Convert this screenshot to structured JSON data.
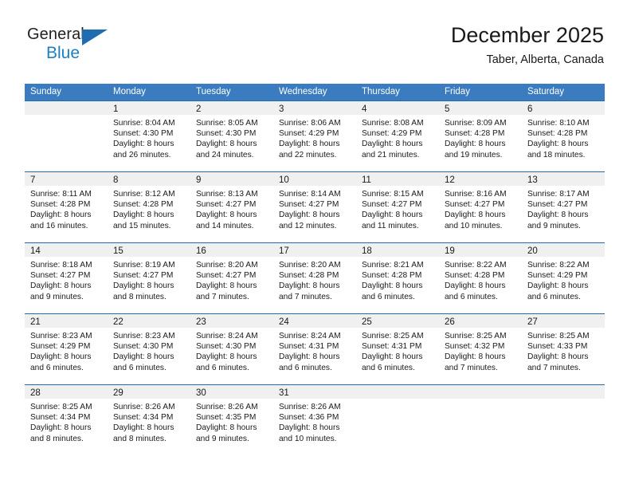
{
  "brand": {
    "name_part1": "General",
    "name_part2": "Blue",
    "triangle_icon": "triangle-icon",
    "accent_dark": "#231f20",
    "accent_blue": "#1c7fc4",
    "triangle_blue": "#1f6cb0"
  },
  "header": {
    "title": "December 2025",
    "subtitle": "Taber, Alberta, Canada"
  },
  "colors": {
    "header_bar": "#3a7cbf",
    "row_divider": "#1f6cb0",
    "daynum_band": "#f0f0f0",
    "text": "#1a1a1a"
  },
  "weekdays": [
    "Sunday",
    "Monday",
    "Tuesday",
    "Wednesday",
    "Thursday",
    "Friday",
    "Saturday"
  ],
  "weeks": [
    [
      {
        "day": "",
        "sunrise": "",
        "sunset": "",
        "daylight_line1": "",
        "daylight_line2": ""
      },
      {
        "day": "1",
        "sunrise": "Sunrise: 8:04 AM",
        "sunset": "Sunset: 4:30 PM",
        "daylight_line1": "Daylight: 8 hours",
        "daylight_line2": "and 26 minutes."
      },
      {
        "day": "2",
        "sunrise": "Sunrise: 8:05 AM",
        "sunset": "Sunset: 4:30 PM",
        "daylight_line1": "Daylight: 8 hours",
        "daylight_line2": "and 24 minutes."
      },
      {
        "day": "3",
        "sunrise": "Sunrise: 8:06 AM",
        "sunset": "Sunset: 4:29 PM",
        "daylight_line1": "Daylight: 8 hours",
        "daylight_line2": "and 22 minutes."
      },
      {
        "day": "4",
        "sunrise": "Sunrise: 8:08 AM",
        "sunset": "Sunset: 4:29 PM",
        "daylight_line1": "Daylight: 8 hours",
        "daylight_line2": "and 21 minutes."
      },
      {
        "day": "5",
        "sunrise": "Sunrise: 8:09 AM",
        "sunset": "Sunset: 4:28 PM",
        "daylight_line1": "Daylight: 8 hours",
        "daylight_line2": "and 19 minutes."
      },
      {
        "day": "6",
        "sunrise": "Sunrise: 8:10 AM",
        "sunset": "Sunset: 4:28 PM",
        "daylight_line1": "Daylight: 8 hours",
        "daylight_line2": "and 18 minutes."
      }
    ],
    [
      {
        "day": "7",
        "sunrise": "Sunrise: 8:11 AM",
        "sunset": "Sunset: 4:28 PM",
        "daylight_line1": "Daylight: 8 hours",
        "daylight_line2": "and 16 minutes."
      },
      {
        "day": "8",
        "sunrise": "Sunrise: 8:12 AM",
        "sunset": "Sunset: 4:28 PM",
        "daylight_line1": "Daylight: 8 hours",
        "daylight_line2": "and 15 minutes."
      },
      {
        "day": "9",
        "sunrise": "Sunrise: 8:13 AM",
        "sunset": "Sunset: 4:27 PM",
        "daylight_line1": "Daylight: 8 hours",
        "daylight_line2": "and 14 minutes."
      },
      {
        "day": "10",
        "sunrise": "Sunrise: 8:14 AM",
        "sunset": "Sunset: 4:27 PM",
        "daylight_line1": "Daylight: 8 hours",
        "daylight_line2": "and 12 minutes."
      },
      {
        "day": "11",
        "sunrise": "Sunrise: 8:15 AM",
        "sunset": "Sunset: 4:27 PM",
        "daylight_line1": "Daylight: 8 hours",
        "daylight_line2": "and 11 minutes."
      },
      {
        "day": "12",
        "sunrise": "Sunrise: 8:16 AM",
        "sunset": "Sunset: 4:27 PM",
        "daylight_line1": "Daylight: 8 hours",
        "daylight_line2": "and 10 minutes."
      },
      {
        "day": "13",
        "sunrise": "Sunrise: 8:17 AM",
        "sunset": "Sunset: 4:27 PM",
        "daylight_line1": "Daylight: 8 hours",
        "daylight_line2": "and 9 minutes."
      }
    ],
    [
      {
        "day": "14",
        "sunrise": "Sunrise: 8:18 AM",
        "sunset": "Sunset: 4:27 PM",
        "daylight_line1": "Daylight: 8 hours",
        "daylight_line2": "and 9 minutes."
      },
      {
        "day": "15",
        "sunrise": "Sunrise: 8:19 AM",
        "sunset": "Sunset: 4:27 PM",
        "daylight_line1": "Daylight: 8 hours",
        "daylight_line2": "and 8 minutes."
      },
      {
        "day": "16",
        "sunrise": "Sunrise: 8:20 AM",
        "sunset": "Sunset: 4:27 PM",
        "daylight_line1": "Daylight: 8 hours",
        "daylight_line2": "and 7 minutes."
      },
      {
        "day": "17",
        "sunrise": "Sunrise: 8:20 AM",
        "sunset": "Sunset: 4:28 PM",
        "daylight_line1": "Daylight: 8 hours",
        "daylight_line2": "and 7 minutes."
      },
      {
        "day": "18",
        "sunrise": "Sunrise: 8:21 AM",
        "sunset": "Sunset: 4:28 PM",
        "daylight_line1": "Daylight: 8 hours",
        "daylight_line2": "and 6 minutes."
      },
      {
        "day": "19",
        "sunrise": "Sunrise: 8:22 AM",
        "sunset": "Sunset: 4:28 PM",
        "daylight_line1": "Daylight: 8 hours",
        "daylight_line2": "and 6 minutes."
      },
      {
        "day": "20",
        "sunrise": "Sunrise: 8:22 AM",
        "sunset": "Sunset: 4:29 PM",
        "daylight_line1": "Daylight: 8 hours",
        "daylight_line2": "and 6 minutes."
      }
    ],
    [
      {
        "day": "21",
        "sunrise": "Sunrise: 8:23 AM",
        "sunset": "Sunset: 4:29 PM",
        "daylight_line1": "Daylight: 8 hours",
        "daylight_line2": "and 6 minutes."
      },
      {
        "day": "22",
        "sunrise": "Sunrise: 8:23 AM",
        "sunset": "Sunset: 4:30 PM",
        "daylight_line1": "Daylight: 8 hours",
        "daylight_line2": "and 6 minutes."
      },
      {
        "day": "23",
        "sunrise": "Sunrise: 8:24 AM",
        "sunset": "Sunset: 4:30 PM",
        "daylight_line1": "Daylight: 8 hours",
        "daylight_line2": "and 6 minutes."
      },
      {
        "day": "24",
        "sunrise": "Sunrise: 8:24 AM",
        "sunset": "Sunset: 4:31 PM",
        "daylight_line1": "Daylight: 8 hours",
        "daylight_line2": "and 6 minutes."
      },
      {
        "day": "25",
        "sunrise": "Sunrise: 8:25 AM",
        "sunset": "Sunset: 4:31 PM",
        "daylight_line1": "Daylight: 8 hours",
        "daylight_line2": "and 6 minutes."
      },
      {
        "day": "26",
        "sunrise": "Sunrise: 8:25 AM",
        "sunset": "Sunset: 4:32 PM",
        "daylight_line1": "Daylight: 8 hours",
        "daylight_line2": "and 7 minutes."
      },
      {
        "day": "27",
        "sunrise": "Sunrise: 8:25 AM",
        "sunset": "Sunset: 4:33 PM",
        "daylight_line1": "Daylight: 8 hours",
        "daylight_line2": "and 7 minutes."
      }
    ],
    [
      {
        "day": "28",
        "sunrise": "Sunrise: 8:25 AM",
        "sunset": "Sunset: 4:34 PM",
        "daylight_line1": "Daylight: 8 hours",
        "daylight_line2": "and 8 minutes."
      },
      {
        "day": "29",
        "sunrise": "Sunrise: 8:26 AM",
        "sunset": "Sunset: 4:34 PM",
        "daylight_line1": "Daylight: 8 hours",
        "daylight_line2": "and 8 minutes."
      },
      {
        "day": "30",
        "sunrise": "Sunrise: 8:26 AM",
        "sunset": "Sunset: 4:35 PM",
        "daylight_line1": "Daylight: 8 hours",
        "daylight_line2": "and 9 minutes."
      },
      {
        "day": "31",
        "sunrise": "Sunrise: 8:26 AM",
        "sunset": "Sunset: 4:36 PM",
        "daylight_line1": "Daylight: 8 hours",
        "daylight_line2": "and 10 minutes."
      },
      {
        "day": "",
        "sunrise": "",
        "sunset": "",
        "daylight_line1": "",
        "daylight_line2": ""
      },
      {
        "day": "",
        "sunrise": "",
        "sunset": "",
        "daylight_line1": "",
        "daylight_line2": ""
      },
      {
        "day": "",
        "sunrise": "",
        "sunset": "",
        "daylight_line1": "",
        "daylight_line2": ""
      }
    ]
  ]
}
